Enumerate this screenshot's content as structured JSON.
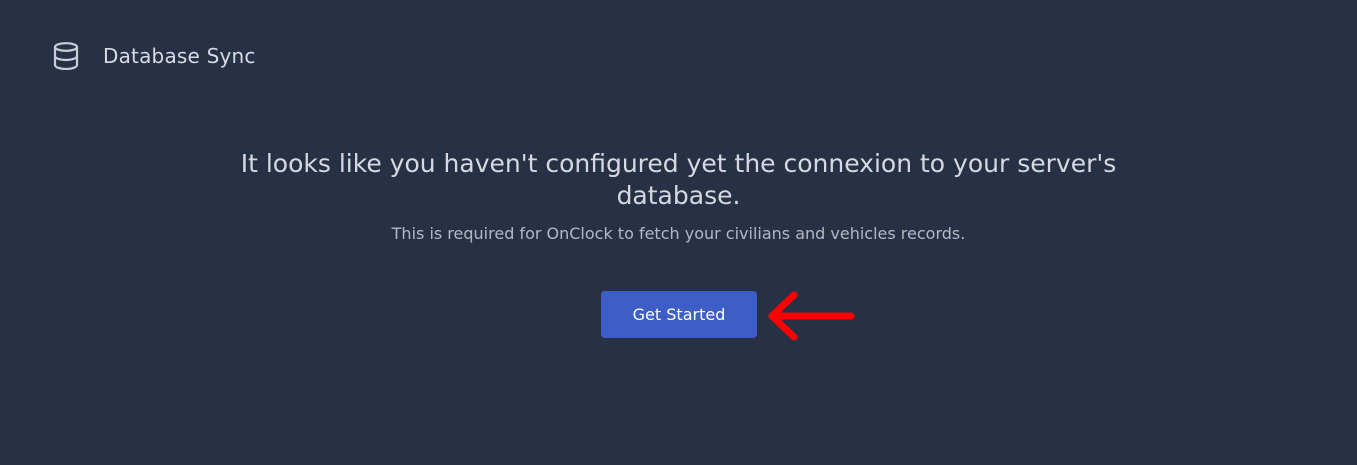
{
  "header": {
    "icon": "database-icon",
    "title": "Database Sync"
  },
  "main": {
    "heading": "It looks like you haven't configured yet the connexion to your server's database.",
    "subtext": "This is required for OnClock to fetch your civilians and vehicles records.",
    "cta_label": "Get Started"
  },
  "colors": {
    "background": "#283046",
    "button": "#3e5ec7",
    "annotation_arrow": "#ff0000"
  }
}
